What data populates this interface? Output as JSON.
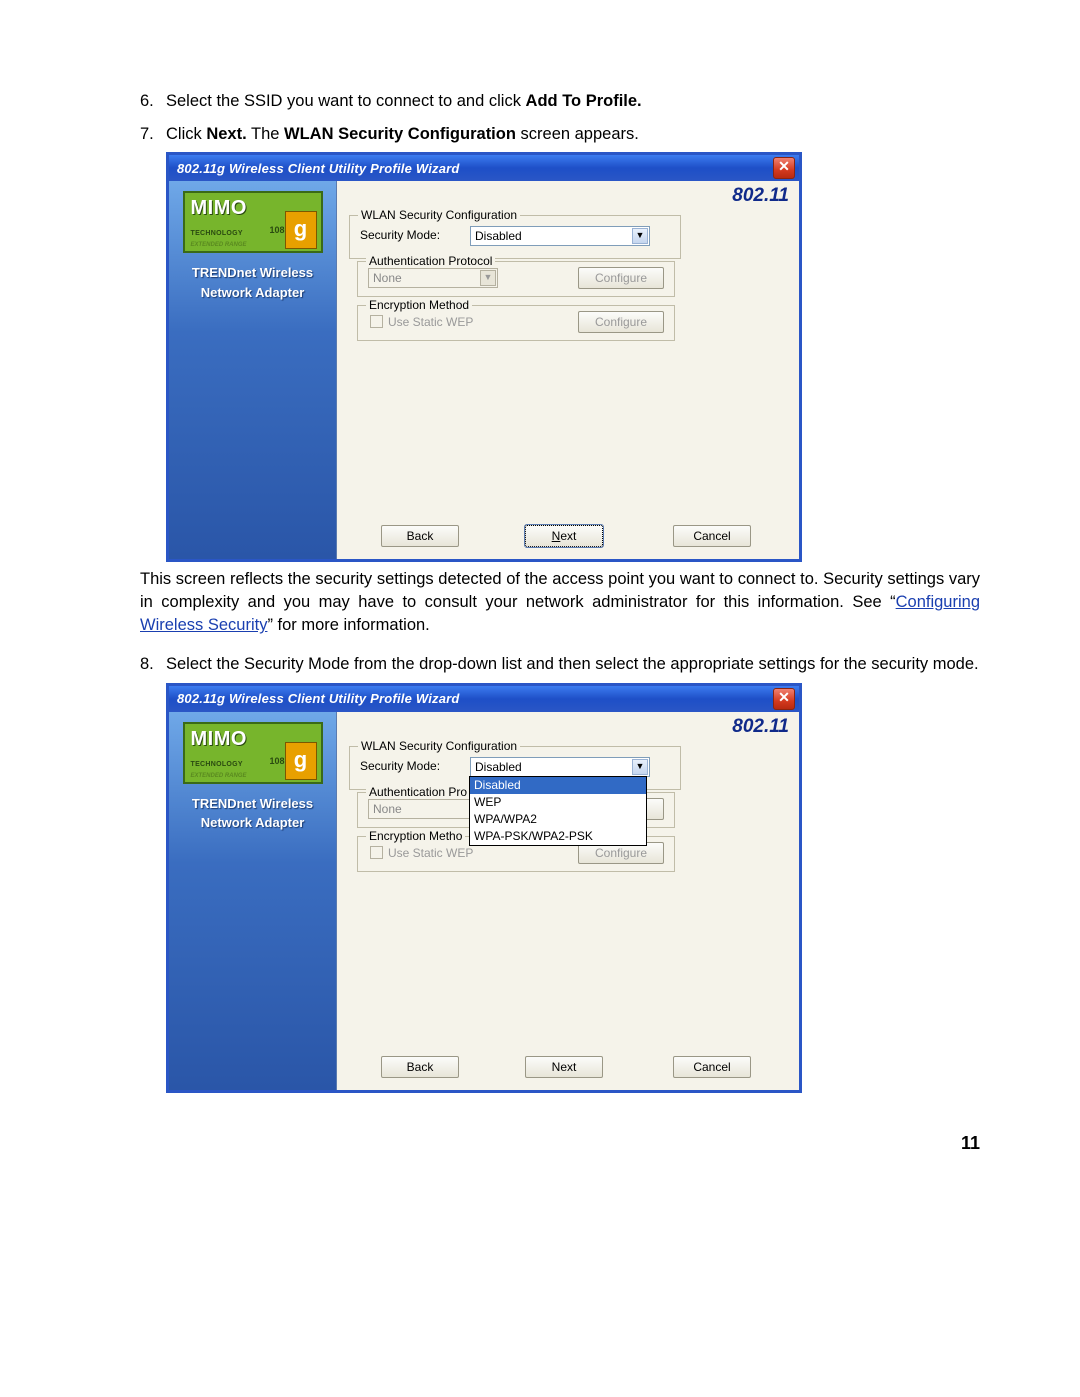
{
  "page_number": "11",
  "steps": {
    "s6": {
      "num": "6.",
      "text_a": "Select the SSID you want to connect to and click ",
      "bold": "Add To Profile."
    },
    "s7": {
      "num": "7.",
      "text_a": "Click ",
      "bold_a": "Next.",
      "text_b": " The ",
      "bold_b": "WLAN Security Configuration",
      "text_c": " screen appears."
    },
    "after7_a": "This screen reflects the security settings detected of the access point you want to connect to. Security settings vary in complexity and you may have to consult your network administrator for this information. See “",
    "after7_link": "Configuring Wireless Security",
    "after7_b": "” for more information.",
    "s8": {
      "num": "8.",
      "text": "Select the Security Mode from the drop-down list and then select the appropriate settings for the security mode."
    }
  },
  "window": {
    "title": "802.11g Wireless Client Utility Profile Wizard",
    "brand": "802.11",
    "sidebar": {
      "logo_main": "MIMO",
      "logo_g": "g",
      "logo_tech": "TECHNOLOGY",
      "logo_108": "108",
      "logo_ext": "EXTENDED RANGE",
      "line1": "TRENDnet Wireless",
      "line2": "Network Adapter"
    },
    "group_security_title": "WLAN Security Configuration",
    "security_mode_label": "Security Mode:",
    "security_mode_value": "Disabled",
    "group_auth_title": "Authentication Protocol",
    "auth_value": "None",
    "auth_configure": "Configure",
    "group_enc_title": "Encryption Method",
    "enc_checkbox_label": "Use Static WEP",
    "enc_configure": "Configure",
    "btn_back": "Back",
    "btn_next_u": "N",
    "btn_next_rest": "ext",
    "btn_next": "Next",
    "btn_cancel": "Cancel",
    "dropdown": {
      "opt1": "Disabled",
      "opt2": "WEP",
      "opt3": "WPA/WPA2",
      "opt4": "WPA-PSK/WPA2-PSK"
    }
  }
}
